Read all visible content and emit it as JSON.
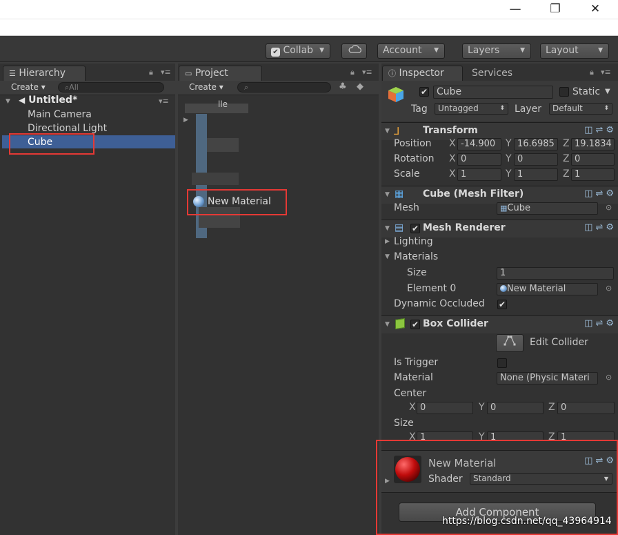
{
  "window": {
    "minimize": "—",
    "maximize": "❐",
    "close": "✕"
  },
  "toolbar": {
    "collab": "Collab",
    "account": "Account",
    "layers": "Layers",
    "layout": "Layout"
  },
  "hierarchy": {
    "tab": "Hierarchy",
    "create": "Create",
    "search_placeholder": "All",
    "scene": "Untitled*",
    "items": [
      "Main Camera",
      "Directional Light",
      "Cube"
    ]
  },
  "project": {
    "tab": "Project",
    "create": "Create",
    "partial_label": "lle",
    "asset": "New Material"
  },
  "inspector": {
    "tab": "Inspector",
    "tab_services": "Services",
    "object_name": "Cube",
    "static_label": "Static",
    "tag_label": "Tag",
    "tag_value": "Untagged",
    "layer_label": "Layer",
    "layer_value": "Default",
    "transform": {
      "title": "Transform",
      "position_label": "Position",
      "position": {
        "x": "-14.900",
        "y": "16.6985",
        "z": "19.1834"
      },
      "rotation_label": "Rotation",
      "rotation": {
        "x": "0",
        "y": "0",
        "z": "0"
      },
      "scale_label": "Scale",
      "scale": {
        "x": "1",
        "y": "1",
        "z": "1"
      }
    },
    "mesh_filter": {
      "title": "Cube (Mesh Filter)",
      "mesh_label": "Mesh",
      "mesh_value": "Cube"
    },
    "mesh_renderer": {
      "title": "Mesh Renderer",
      "lighting": "Lighting",
      "materials": "Materials",
      "size_label": "Size",
      "size_value": "1",
      "element_label": "Element 0",
      "element_value": "New Material",
      "dynamic_label": "Dynamic Occluded"
    },
    "box_collider": {
      "title": "Box Collider",
      "edit_collider": "Edit Collider",
      "is_trigger": "Is Trigger",
      "material_label": "Material",
      "material_value": "None (Physic Materi",
      "center_label": "Center",
      "center": {
        "x": "0",
        "y": "0",
        "z": "0"
      },
      "size_label": "Size",
      "size": {
        "x": "1",
        "y": "1",
        "z": "1"
      }
    },
    "material": {
      "name": "New Material",
      "shader_label": "Shader",
      "shader_value": "Standard"
    },
    "add_component": "Add Component"
  },
  "axis": {
    "x": "X",
    "y": "Y",
    "z": "Z"
  },
  "watermark": "https://blog.csdn.net/qq_43964914"
}
